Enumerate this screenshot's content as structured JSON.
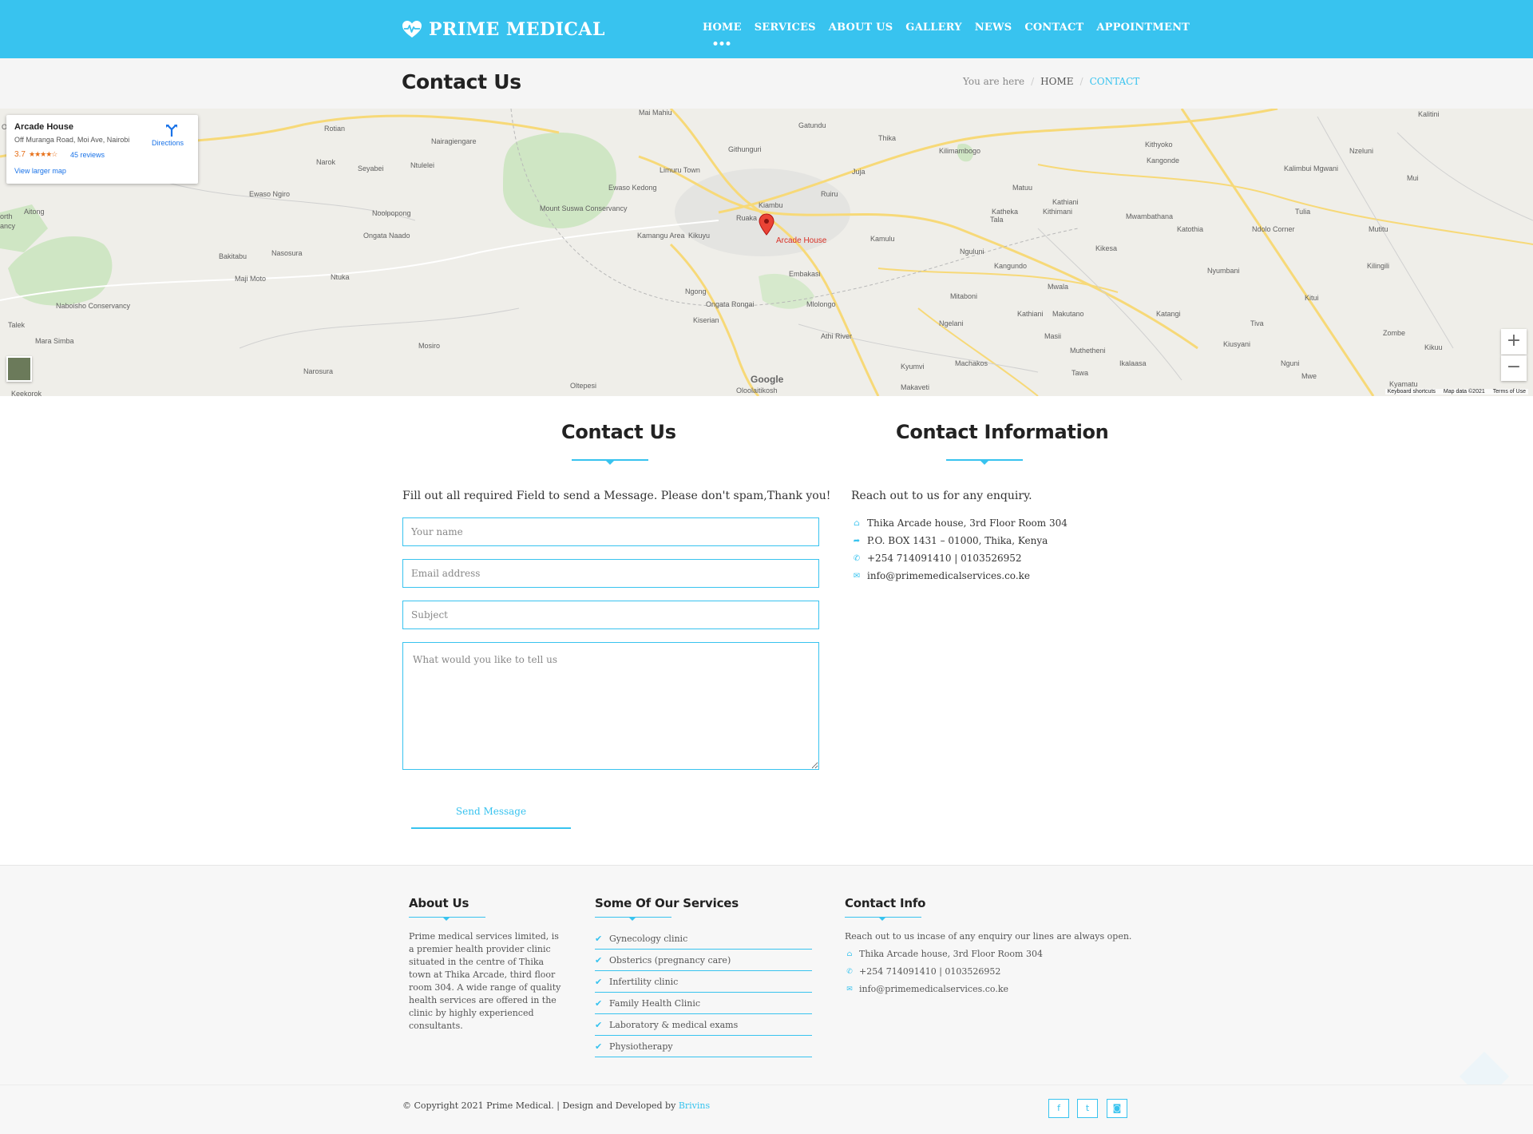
{
  "nav": {
    "brand": "PRIME MEDICAL",
    "items": [
      {
        "label": "HOME"
      },
      {
        "label": "SERVICES"
      },
      {
        "label": "ABOUT US"
      },
      {
        "label": "GALLERY"
      },
      {
        "label": "NEWS"
      },
      {
        "label": "CONTACT"
      },
      {
        "label": "APPOINTMENT"
      }
    ]
  },
  "title_band": {
    "title": "Contact Us",
    "breadcrumb_prefix": "You are here",
    "breadcrumb_home": "HOME",
    "breadcrumb_current": "CONTACT",
    "separator": "/"
  },
  "map": {
    "place_name": "Arcade House",
    "place_address": "Off Muranga Road, Moi Ave, Nairobi",
    "rating": "3.7",
    "stars": "★★★★☆",
    "reviews": "45 reviews",
    "directions": "Directions",
    "larger_map": "View larger map",
    "pin_label": "Arcade House",
    "zoom_in": "+",
    "zoom_out": "−",
    "google": "Google",
    "keyboard": "Keyboard shortcuts",
    "map_data": "Map data ©2021",
    "terms": "Terms of Use",
    "place_labels": [
      {
        "text": "Thika"
      },
      {
        "text": "Ruiru"
      },
      {
        "text": "Athi River"
      },
      {
        "text": "Kiambu"
      },
      {
        "text": "Juja"
      },
      {
        "text": "Kamulu"
      },
      {
        "text": "Ngong"
      },
      {
        "text": "Kiserian"
      },
      {
        "text": "Ongata Rongai"
      },
      {
        "text": "Mlolongo"
      },
      {
        "text": "Limuru Town"
      },
      {
        "text": "Githunguri"
      },
      {
        "text": "Gatundu"
      },
      {
        "text": "Kilimambogo"
      },
      {
        "text": "Matuu"
      },
      {
        "text": "Kangonde"
      },
      {
        "text": "Kithyoko"
      },
      {
        "text": "Nzeluni"
      },
      {
        "text": "Kalimbui Mgwani"
      },
      {
        "text": "Tala"
      },
      {
        "text": "Kangundo"
      },
      {
        "text": "Mwala"
      },
      {
        "text": "Machakos"
      },
      {
        "text": "Masii"
      },
      {
        "text": "Kikesa"
      },
      {
        "text": "Katheka"
      },
      {
        "text": "Kithimani"
      },
      {
        "text": "Mwambathana"
      },
      {
        "text": "Katothia"
      },
      {
        "text": "Ndolo Corner"
      },
      {
        "text": "Tulia"
      },
      {
        "text": "Mutitu"
      },
      {
        "text": "Kilingili"
      },
      {
        "text": "Nyumbani"
      },
      {
        "text": "Kitui"
      },
      {
        "text": "Zombe"
      },
      {
        "text": "Kikuu"
      },
      {
        "text": "Nguni"
      },
      {
        "text": "Mwe"
      },
      {
        "text": "Kyamatu"
      },
      {
        "text": "Tiva"
      },
      {
        "text": "Kiusyani"
      },
      {
        "text": "Katangi"
      },
      {
        "text": "Ikalaasa"
      },
      {
        "text": "Tawa"
      },
      {
        "text": "Makaveti"
      },
      {
        "text": "Kyumvi"
      },
      {
        "text": "Muthetheni"
      },
      {
        "text": "Makutano"
      },
      {
        "text": "Kathiani"
      },
      {
        "text": "Ngelani"
      },
      {
        "text": "Mitaboni"
      },
      {
        "text": "Nguluni"
      },
      {
        "text": "Kamangu Area"
      },
      {
        "text": "Kikuyu"
      },
      {
        "text": "Ruaka"
      },
      {
        "text": "Ewaso Kedong"
      },
      {
        "text": "Mount Suswa Conservancy"
      },
      {
        "text": "Nairagiengare"
      },
      {
        "text": "Ntulelei"
      },
      {
        "text": "Seyabei"
      },
      {
        "text": "Narok"
      },
      {
        "text": "Rotian"
      },
      {
        "text": "Ololulunga"
      },
      {
        "text": "Ewaso Ngiro"
      },
      {
        "text": "Aitong"
      },
      {
        "text": "Noolpopong"
      },
      {
        "text": "Ongata Naado"
      },
      {
        "text": "Bakitabu"
      },
      {
        "text": "Nasosura"
      },
      {
        "text": "Maji Moto"
      },
      {
        "text": "Ntuka"
      },
      {
        "text": "Naboisho Conservancy"
      },
      {
        "text": "Talek"
      },
      {
        "text": "Mara Simba"
      },
      {
        "text": "Mosiro"
      },
      {
        "text": "Narosura"
      },
      {
        "text": "Oltepesi"
      },
      {
        "text": "Oloolaitikosh"
      },
      {
        "text": "Mai Mahiu"
      },
      {
        "text": "Kalitini"
      },
      {
        "text": "Mui"
      },
      {
        "text": "Kathiani"
      },
      {
        "text": "Embakasi"
      },
      {
        "text": "Keekorok"
      },
      {
        "text": "orth"
      },
      {
        "text": "ancy"
      }
    ]
  },
  "contact_form": {
    "title": "Contact Us",
    "intro": "Fill out all required Field to send a Message. Please don't spam,Thank you!",
    "name_placeholder": "Your name",
    "email_placeholder": "Email address",
    "subject_placeholder": "Subject",
    "message_placeholder": "What would you like to tell us",
    "send_label": "Send Message"
  },
  "contact_info": {
    "title": "Contact Information",
    "intro": "Reach out to us for any enquiry.",
    "address": "Thika Arcade house, 3rd Floor Room 304",
    "pobox": "P.O. BOX 1431 – 01000, Thika, Kenya",
    "phone": "+254 714091410 | 0103526952",
    "email": "info@primemedicalservices.co.ke"
  },
  "footer": {
    "about_title": "About Us",
    "about_text": "Prime medical services limited, is a premier health provider clinic situated in the centre of Thika town at Thika Arcade, third floor room 304. A wide range of quality health services are offered in the clinic by highly experienced consultants.",
    "services_title": "Some Of Our Services",
    "services": [
      "Gynecology clinic",
      "Obsterics (pregnancy care)",
      "Infertility clinic",
      "Family Health Clinic",
      "Laboratory & medical exams",
      "Physiotherapy"
    ],
    "contact_title": "Contact Info",
    "contact_intro": "Reach out to us incase of any enquiry our lines are always open.",
    "contact_address": "Thika Arcade house, 3rd Floor Room 304",
    "contact_phone": "+254 714091410 | 0103526952",
    "contact_email": "info@primemedicalservices.co.ke"
  },
  "bottom": {
    "copyright": "© Copyright 2021 Prime Medical. | Design and Developed by ",
    "developer": "Brivins",
    "social": [
      {
        "icon": "facebook-icon",
        "glyph": "f"
      },
      {
        "icon": "twitter-icon",
        "glyph": "t"
      },
      {
        "icon": "instagram-icon",
        "glyph": "◙"
      }
    ]
  },
  "colors": {
    "accent": "#38c3ef",
    "pin": "#d93025"
  }
}
